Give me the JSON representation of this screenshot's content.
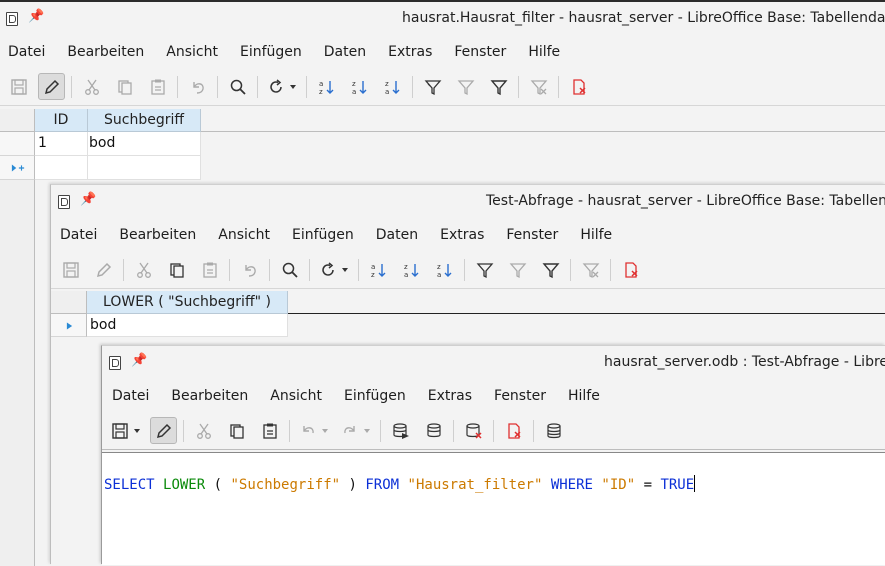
{
  "window1": {
    "title": "hausrat.Hausrat_filter - hausrat_server - LibreOffice Base: Tabellendat",
    "menu": [
      "Datei",
      "Bearbeiten",
      "Ansicht",
      "Einfügen",
      "Daten",
      "Extras",
      "Fenster",
      "Hilfe"
    ],
    "table": {
      "columns": [
        "ID",
        "Suchbegriff"
      ],
      "rows": [
        [
          "1",
          "bod"
        ]
      ]
    }
  },
  "window2": {
    "title": "Test-Abfrage - hausrat_server - LibreOffice Base: Tabellen",
    "menu": [
      "Datei",
      "Bearbeiten",
      "Ansicht",
      "Einfügen",
      "Daten",
      "Extras",
      "Fenster",
      "Hilfe"
    ],
    "table": {
      "columns": [
        "LOWER ( \"Suchbegriff\" )"
      ],
      "rows": [
        [
          "bod"
        ]
      ]
    }
  },
  "window3": {
    "title": "hausrat_server.odb : Test-Abfrage - Libre",
    "menu": [
      "Datei",
      "Bearbeiten",
      "Ansicht",
      "Einfügen",
      "Extras",
      "Fenster",
      "Hilfe"
    ],
    "sql": {
      "kw_select": "SELECT",
      "kw_lower": "LOWER",
      "paren_open": "(",
      "str_field": "\"Suchbegriff\"",
      "paren_close": ")",
      "kw_from": "FROM",
      "str_table": "\"Hausrat_filter\"",
      "kw_where": "WHERE",
      "str_id": "\"ID\"",
      "op_eq": "=",
      "kw_true": "TRUE"
    }
  },
  "colors": {
    "keyword": "#0b2fd6",
    "string": "#cc7a00",
    "header_bg": "#d7e9f7",
    "delete_red": "#e03030",
    "record_arrow": "#2a8ad4"
  }
}
